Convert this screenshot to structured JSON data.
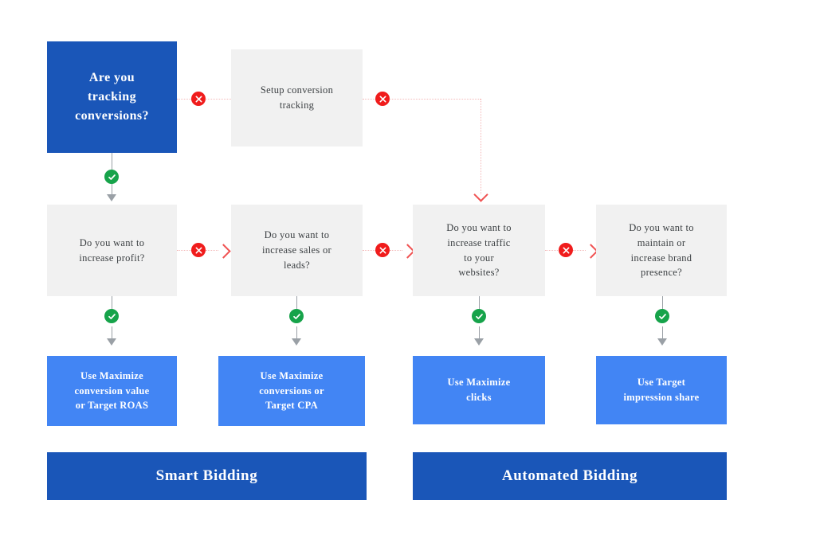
{
  "diagram": {
    "title": "Google Ads bidding strategy decision flowchart",
    "colors": {
      "primary_blue": "#1a56b8",
      "accent_blue": "#4285f4",
      "neutral_gray": "#f1f1f1",
      "no_red": "#f01c1c",
      "yes_green": "#16a34a",
      "connector_gray": "#9aa0a6",
      "dotted_red": "#f4b9b9",
      "background": "#ffffff"
    },
    "nodes": {
      "start": {
        "label": "Are you\ntracking\nconversions?"
      },
      "setup": {
        "label": "Setup  conversion\ntracking"
      },
      "q_profit": {
        "label": "Do you want to\nincrease profit?"
      },
      "q_sales": {
        "label": "Do you want to\nincrease sales or\nleads?"
      },
      "q_traffic": {
        "label": "Do you want to\nincrease traffic\nto your\nwebsites?"
      },
      "q_brand": {
        "label": "Do you want to\nmaintain or\nincrease brand\npresence?"
      },
      "r_roas": {
        "label": "Use Maximize\nconversion value\nor Target ROAS"
      },
      "r_cpa": {
        "label": "Use Maximize\nconversions or\nTarget CPA"
      },
      "r_clicks": {
        "label": "Use Maximize\nclicks"
      },
      "r_impression": {
        "label": "Use Target\nimpression share"
      }
    },
    "banners": {
      "smart": {
        "label": "Smart Bidding"
      },
      "automated": {
        "label": "Automated Bidding"
      }
    },
    "badges": {
      "no_icon": "cross-circle-icon",
      "yes_icon": "check-circle-icon"
    }
  }
}
